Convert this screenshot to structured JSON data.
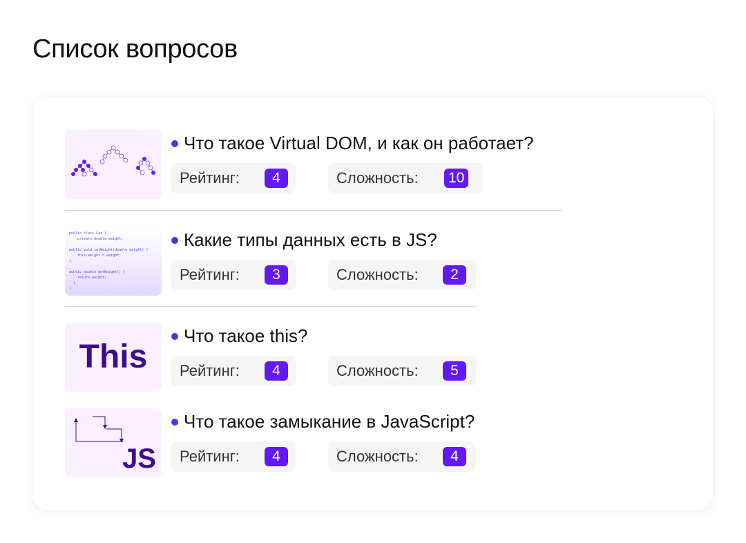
{
  "page": {
    "title": "Список вопросов"
  },
  "labels": {
    "rating": "Рейтинг:",
    "difficulty": "Сложность:"
  },
  "questions": [
    {
      "title": "Что такое Virtual DOM, и как он работает?",
      "rating": "4",
      "difficulty": "10",
      "thumb": {
        "icon": "virtual-dom-tree-diagram"
      }
    },
    {
      "title": "Какие типы данных есть в JS?",
      "rating": "3",
      "difficulty": "2",
      "thumb": {
        "icon": "code-snippet",
        "code": "public class Cat {\n    private double weight;\n\npublic void setWeight(double weight) {\n    this.weight = weight;\n}\n\npublic double getWeight() {\n    return weight;\n  }\n}"
      }
    },
    {
      "title": "Что такое this?",
      "rating": "4",
      "difficulty": "5",
      "thumb": {
        "icon": "this-keyword",
        "text": "This"
      }
    },
    {
      "title": "Что такое замыкание в JavaScript?",
      "rating": "4",
      "difficulty": "4",
      "thumb": {
        "icon": "closure-diagram",
        "text": "JS"
      }
    }
  ],
  "colors": {
    "accent": "#6219f5",
    "bullet": "#5b2bf5",
    "thumb_bg": "#fbf0ff",
    "chip_bg": "#f5f5f5",
    "brand_dark": "#3d0d8f"
  }
}
